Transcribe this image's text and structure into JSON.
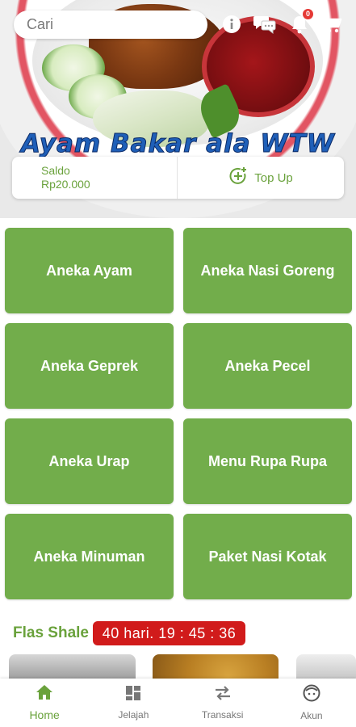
{
  "header": {
    "search_placeholder": "Cari",
    "info_icon": "info-icon",
    "chat_icon": "chat-icon",
    "notification_icon": "bell-icon",
    "notification_count": "0",
    "cart_icon": "cart-icon"
  },
  "banner": {
    "title": "Ayam Bakar ala WTW"
  },
  "saldo": {
    "label": "Saldo",
    "value": "Rp20.000",
    "topup_label": "Top Up",
    "topup_icon": "plus-circle-icon"
  },
  "categories": [
    {
      "label": "Aneka Ayam"
    },
    {
      "label": "Aneka Nasi Goreng"
    },
    {
      "label": "Aneka Geprek"
    },
    {
      "label": "Aneka Pecel"
    },
    {
      "label": "Aneka Urap"
    },
    {
      "label": "Menu Rupa Rupa"
    },
    {
      "label": "Aneka Minuman"
    },
    {
      "label": "Paket Nasi Kotak"
    }
  ],
  "flash_sale": {
    "title": "Flas Shale",
    "timer": "40 hari. 19 : 45 : 36"
  },
  "bottom_nav": [
    {
      "label": "Home",
      "icon": "home-icon",
      "active": true
    },
    {
      "label": "Jelajah",
      "icon": "grid-icon",
      "active": false
    },
    {
      "label": "Transaksi",
      "icon": "swap-arrows-icon",
      "active": false
    },
    {
      "label": "Akun",
      "icon": "account-face-icon",
      "active": false
    }
  ],
  "colors": {
    "brand_green": "#72ad4b",
    "text_green": "#6aa23c",
    "timer_red": "#d11b1b"
  }
}
